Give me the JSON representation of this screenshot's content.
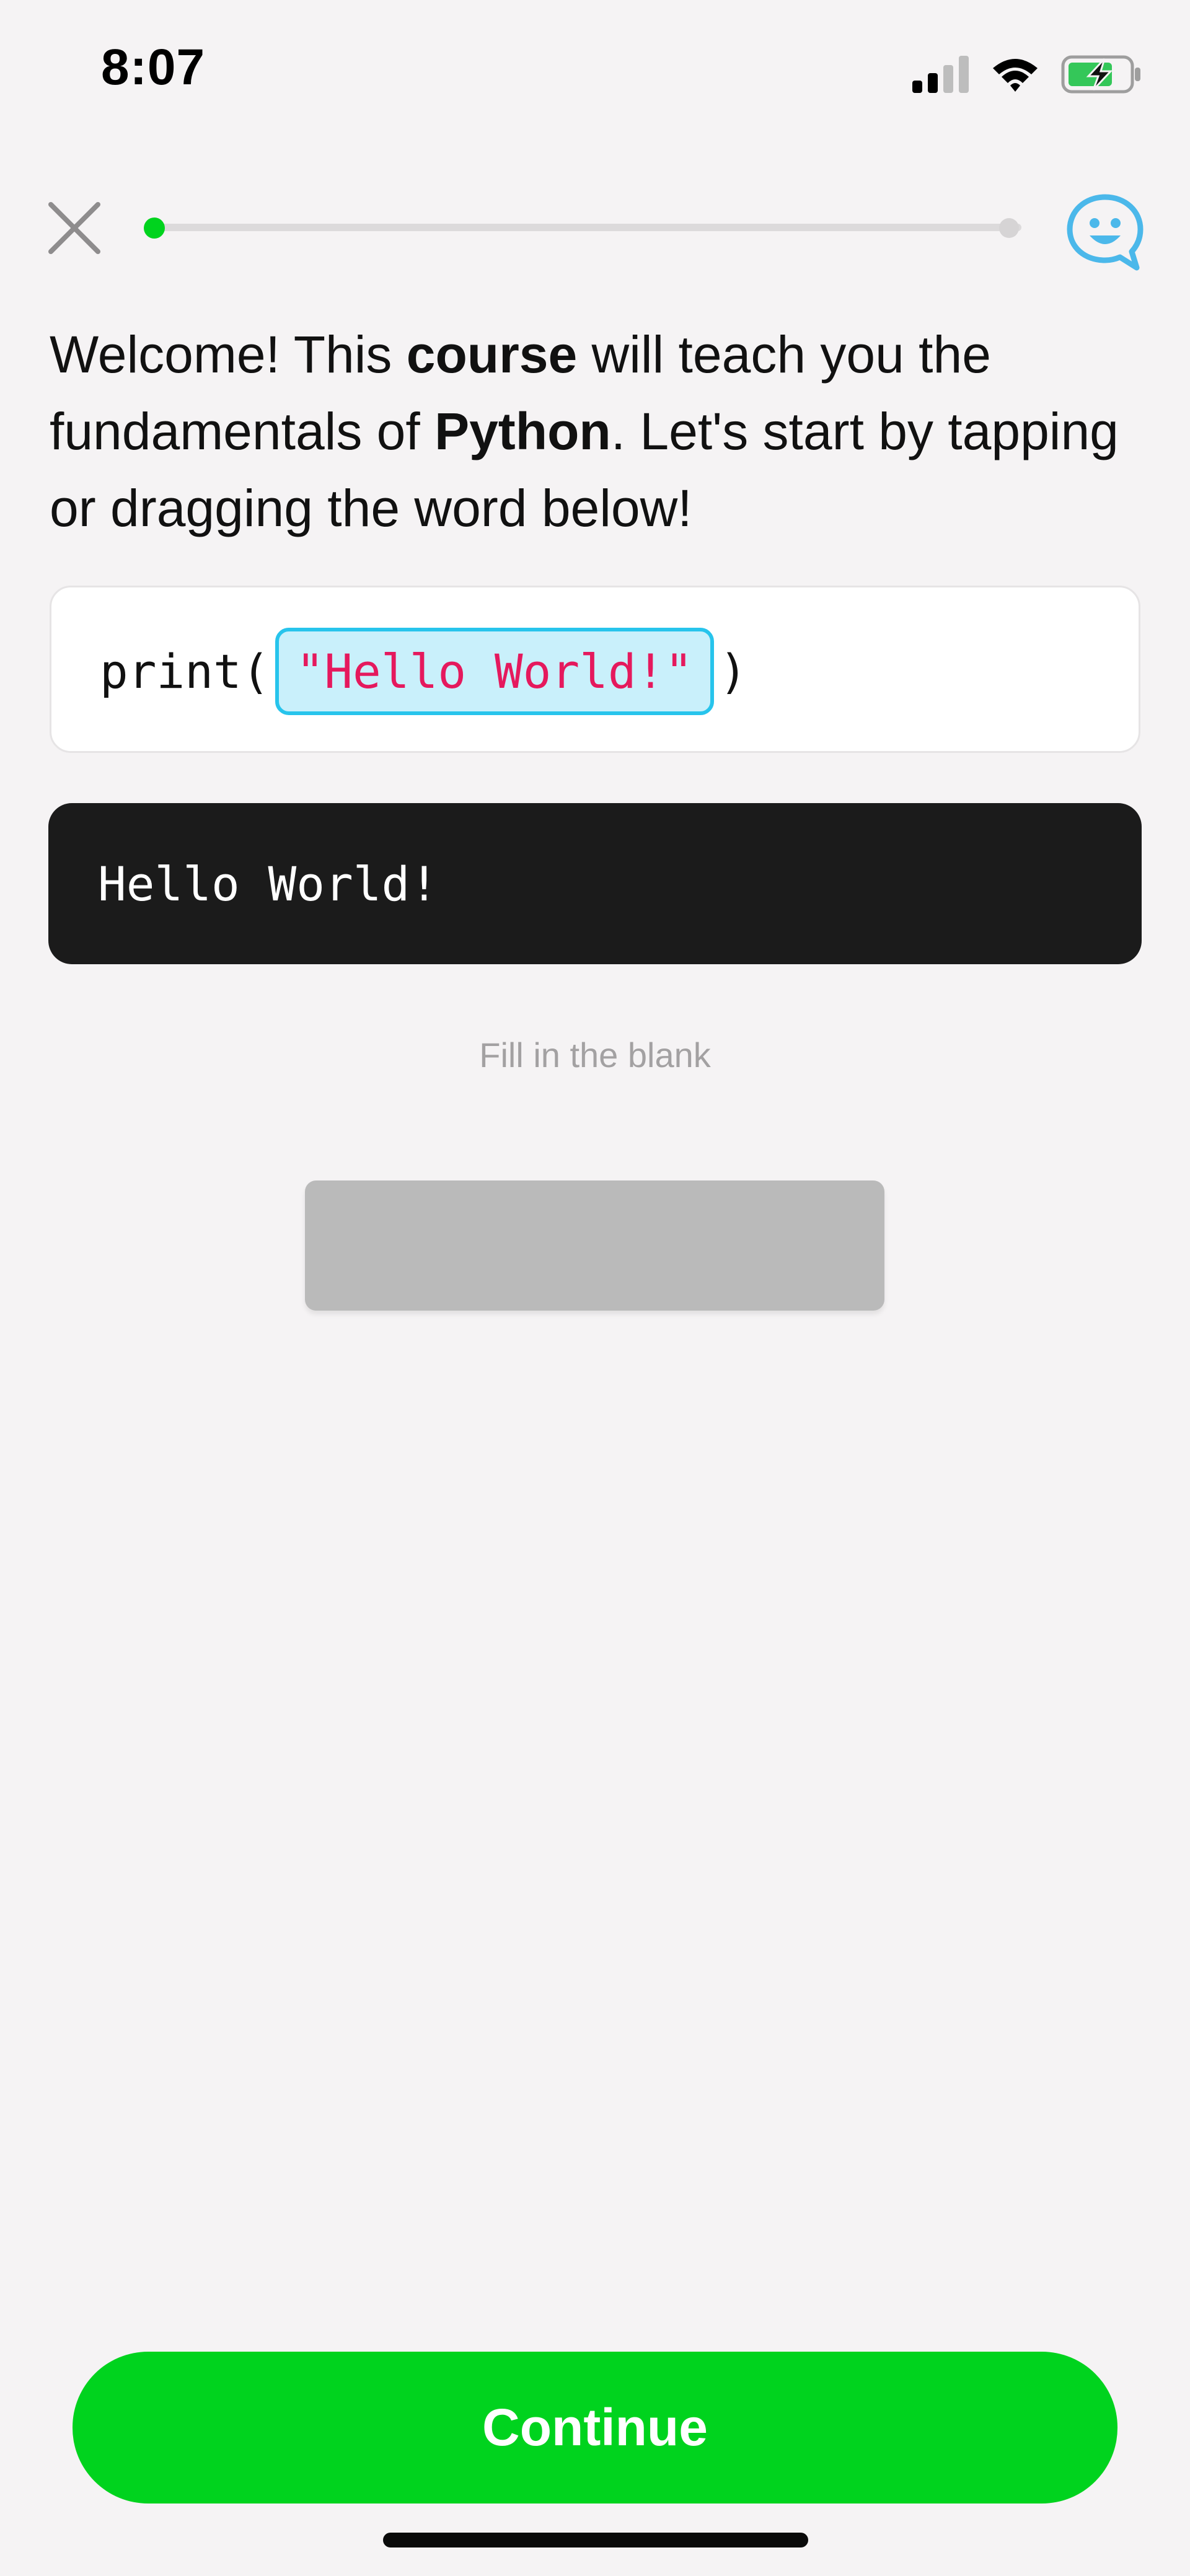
{
  "status_bar": {
    "time": "8:07",
    "icons": [
      "cellular-signal-icon",
      "wifi-icon",
      "battery-charging-icon"
    ]
  },
  "header": {
    "close_icon": "close-icon",
    "feedback_icon": "smiley-chat-icon",
    "progress_fraction": 0.0
  },
  "instruction": {
    "part1": "Welcome!  This ",
    "bold1": "course",
    "part2": " will teach you the fundamentals of ",
    "bold2": "Python",
    "part3": ". Let's start by tapping or dragging the word below!"
  },
  "code": {
    "prefix": "print(",
    "chip": "\"Hello World!\"",
    "suffix": ")"
  },
  "console": {
    "output": "Hello World!"
  },
  "hint": "Fill in the blank",
  "continue_label": "Continue",
  "colors": {
    "background": "#f5f3f4",
    "accent_green": "#00d31e",
    "chip_fill": "#c9f0fb",
    "chip_border": "#27c4ec",
    "string_text": "#e5195d",
    "console_bg": "#1b1b1b",
    "blank_slot": "#bababa",
    "feedback_blue": "#4bb8ea"
  }
}
